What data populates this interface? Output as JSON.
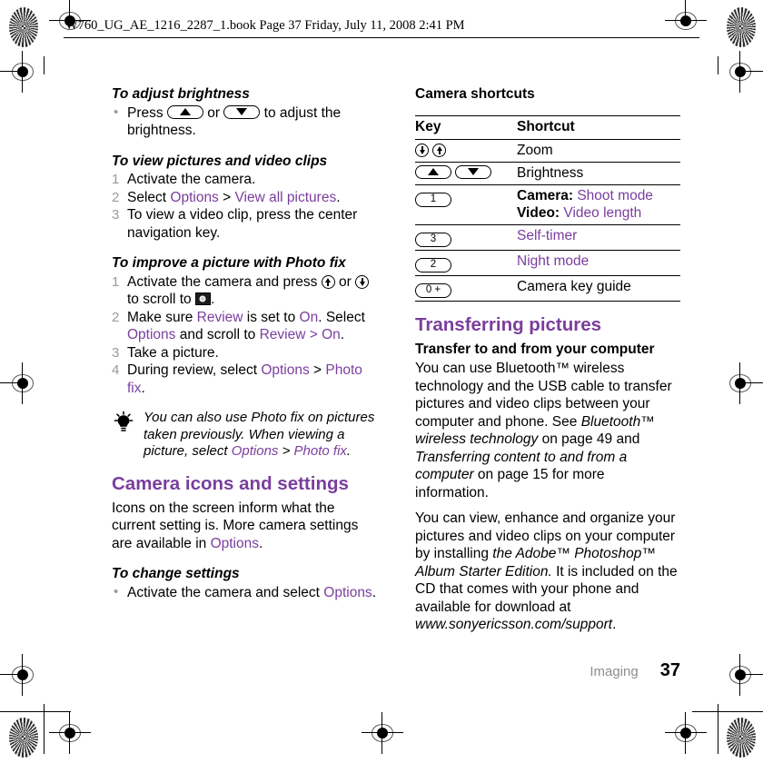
{
  "document": {
    "header_line": "W760_UG_AE_1216_2287_1.book  Page 37  Friday, July 11, 2008  2:41 PM",
    "footer_chapter": "Imaging",
    "footer_page": "37",
    "accent_purple": "#7a3e9d",
    "muted_gray": "#8c8c8c"
  },
  "left_column": {
    "brightness": {
      "heading": "To adjust brightness",
      "bullet_pre": "Press",
      "bullet_mid": "or",
      "bullet_post": "to adjust the brightness."
    },
    "view_pictures": {
      "heading": "To view pictures and video clips",
      "steps": [
        {
          "text": "Activate the camera."
        },
        {
          "pre": "Select ",
          "link1": "Options",
          "sep": " > ",
          "link2": "View all pictures",
          "post": "."
        },
        {
          "text": "To view a video clip, press the center navigation key."
        }
      ]
    },
    "photo_fix": {
      "heading": "To improve a picture with Photo fix",
      "step1_a": "Activate the camera and press",
      "step1_b": "or",
      "step1_c": "to scroll to",
      "step1_d": ".",
      "step2_a": "Make sure ",
      "step2_review1": "Review",
      "step2_b": " is set to ",
      "step2_on1": "On",
      "step2_c": ". Select ",
      "step2_options": "Options",
      "step2_d": " and scroll to ",
      "step2_review2": "Review",
      "step2_e": " > ",
      "step2_on2": "On",
      "step2_f": ".",
      "step3": "Take a picture.",
      "step4_a": "During review, select ",
      "step4_options": "Options",
      "step4_b": " > ",
      "step4_photofix": "Photo fix",
      "step4_c": "."
    },
    "tip": {
      "a": "You can also use Photo fix on pictures taken previously. When viewing a picture, select ",
      "options": "Options",
      "b": " > ",
      "photofix": "Photo fix",
      "c": "."
    },
    "camera_icons": {
      "section_heading": "Camera icons and settings",
      "body_a": "Icons on the screen inform what the current setting is. More camera settings are available in ",
      "body_options": "Options",
      "body_b": "."
    },
    "change_settings": {
      "heading": "To change settings",
      "bullet_a": "Activate the camera and select ",
      "bullet_options": "Options",
      "bullet_b": "."
    }
  },
  "right_column": {
    "shortcuts_table": {
      "title": "Camera shortcuts",
      "columns": [
        "Key",
        "Shortcut"
      ],
      "rows": [
        {
          "key_type": "round-pair",
          "shortcut_plain": "Zoom"
        },
        {
          "key_type": "arrow-pair",
          "shortcut_plain": "Brightness"
        },
        {
          "key_type": "num",
          "key_label": "1",
          "shortcut_line1_bold": "Camera:",
          "shortcut_line1_link": "Shoot mode",
          "shortcut_line2_bold": "Video:",
          "shortcut_line2_link": "Video length"
        },
        {
          "key_type": "num",
          "key_label": "3",
          "shortcut_link": "Self-timer"
        },
        {
          "key_type": "num",
          "key_label": "2",
          "shortcut_link": "Night mode"
        },
        {
          "key_type": "num",
          "key_label": "0 +",
          "shortcut_plain": "Camera key guide"
        }
      ]
    },
    "transferring": {
      "section_heading": "Transferring pictures",
      "sub_heading": "Transfer to and from your computer",
      "p1_a": "You can use Bluetooth™ wireless technology and the USB cable to transfer pictures and video clips between your computer and phone. See ",
      "p1_ital1": "Bluetooth™ wireless technology",
      "p1_b": " on page 49 and ",
      "p1_ital2": "Transferring content to and from a computer",
      "p1_c": " on page 15 for more information.",
      "p2_a": "You can view, enhance and organize your pictures and video clips on your computer by installing ",
      "p2_ital1": "the Adobe™ Photoshop™ Album Starter Edition.",
      "p2_b": " It is included on the CD that comes with your phone and available for download at ",
      "p2_ital2": "www.sonyericsson.com/support",
      "p2_c": "."
    }
  }
}
